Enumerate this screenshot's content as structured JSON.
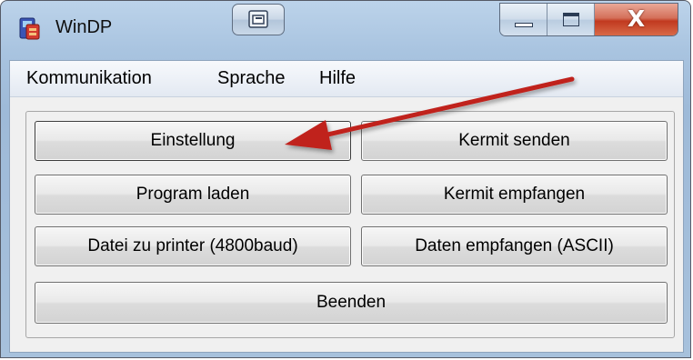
{
  "window": {
    "title": "WinDP"
  },
  "menu": {
    "items": [
      "Kommunikation",
      "Sprache",
      "Hilfe"
    ]
  },
  "buttons": {
    "einstellung": "Einstellung",
    "kermit_senden": "Kermit senden",
    "program_laden": "Program laden",
    "kermit_empfangen": "Kermit empfangen",
    "datei_printer": "Datei zu printer (4800baud)",
    "daten_empfangen": "Daten empfangen (ASCII)",
    "beenden": "Beenden"
  },
  "window_controls": {
    "close_glyph": "X"
  },
  "colors": {
    "arrow": "#c0211f",
    "close_button": "#c1391f",
    "title_bar": "#a9c4e0"
  },
  "icons": [
    "app-icon",
    "extra-titlebar-icon",
    "minimize-icon",
    "maximize-icon",
    "close-icon",
    "annotation-arrow"
  ]
}
